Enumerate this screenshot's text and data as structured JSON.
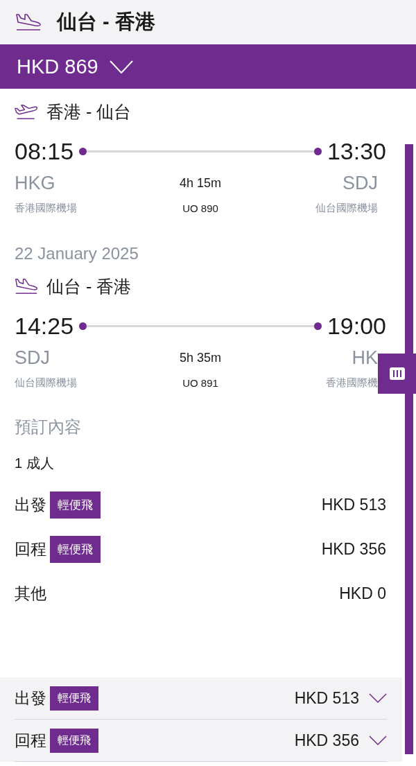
{
  "header": {
    "kind": "landing",
    "title": "仙台 - 香港"
  },
  "total": {
    "amount": "HKD 869"
  },
  "legs": [
    {
      "kind": "takeoff",
      "route": "香港 - 仙台",
      "depart_time": "08:15",
      "arrive_time": "13:30",
      "depart_code": "HKG",
      "arrive_code": "SDJ",
      "duration": "4h 15m",
      "depart_airport": "香港國際機場",
      "flight": "UO 890",
      "arrive_airport": "仙台國際機場"
    },
    {
      "date": "22 January 2025",
      "kind": "landing",
      "route": "仙台 - 香港",
      "depart_time": "14:25",
      "arrive_time": "19:00",
      "depart_code": "SDJ",
      "arrive_code": "HK",
      "duration": "5h 35m",
      "depart_airport": "仙台國際機場",
      "flight": "UO 891",
      "arrive_airport": "香港國際機"
    }
  ],
  "booking": {
    "heading": "預訂內容",
    "passengers": "1 成人",
    "lines": [
      {
        "label": "出發",
        "fare": "輕便飛",
        "price": "HKD 513"
      },
      {
        "label": "回程",
        "fare": "輕便飛",
        "price": "HKD 356"
      },
      {
        "label": "其他",
        "price": "HKD 0"
      }
    ]
  },
  "summary": [
    {
      "label": "出發",
      "fare": "輕便飛",
      "price": "HKD 513"
    },
    {
      "label": "回程",
      "fare": "輕便飛",
      "price": "HKD 356"
    }
  ]
}
